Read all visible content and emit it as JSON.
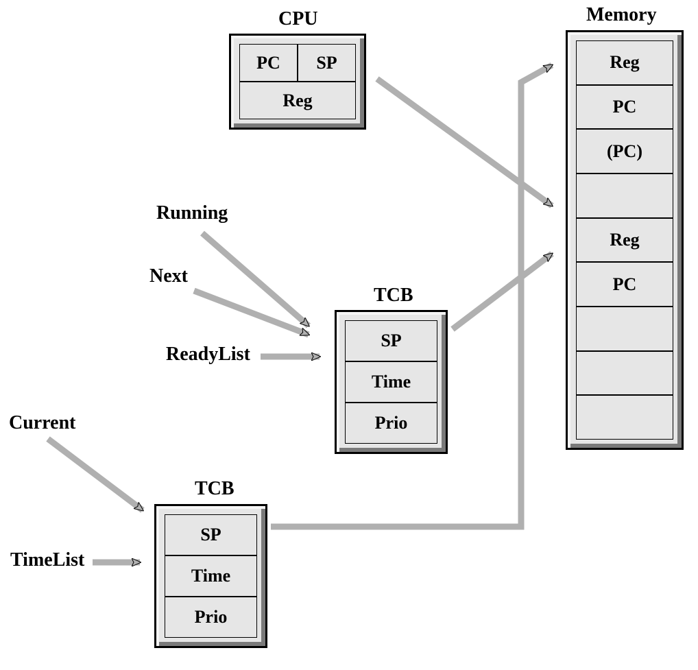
{
  "titles": {
    "cpu": "CPU",
    "memory": "Memory",
    "tcb1": "TCB",
    "tcb2": "TCB"
  },
  "cpu": {
    "pc": "PC",
    "sp": "SP",
    "reg": "Reg"
  },
  "memory": {
    "rows": [
      "Reg",
      "PC",
      "(PC)",
      "",
      "Reg",
      "PC",
      "",
      "",
      ""
    ]
  },
  "tcb1": {
    "sp": "SP",
    "time": "Time",
    "prio": "Prio"
  },
  "tcb2": {
    "sp": "SP",
    "time": "Time",
    "prio": "Prio"
  },
  "pointers": {
    "running": "Running",
    "next": "Next",
    "readylist": "ReadyList",
    "current": "Current",
    "timelist": "TimeList"
  }
}
